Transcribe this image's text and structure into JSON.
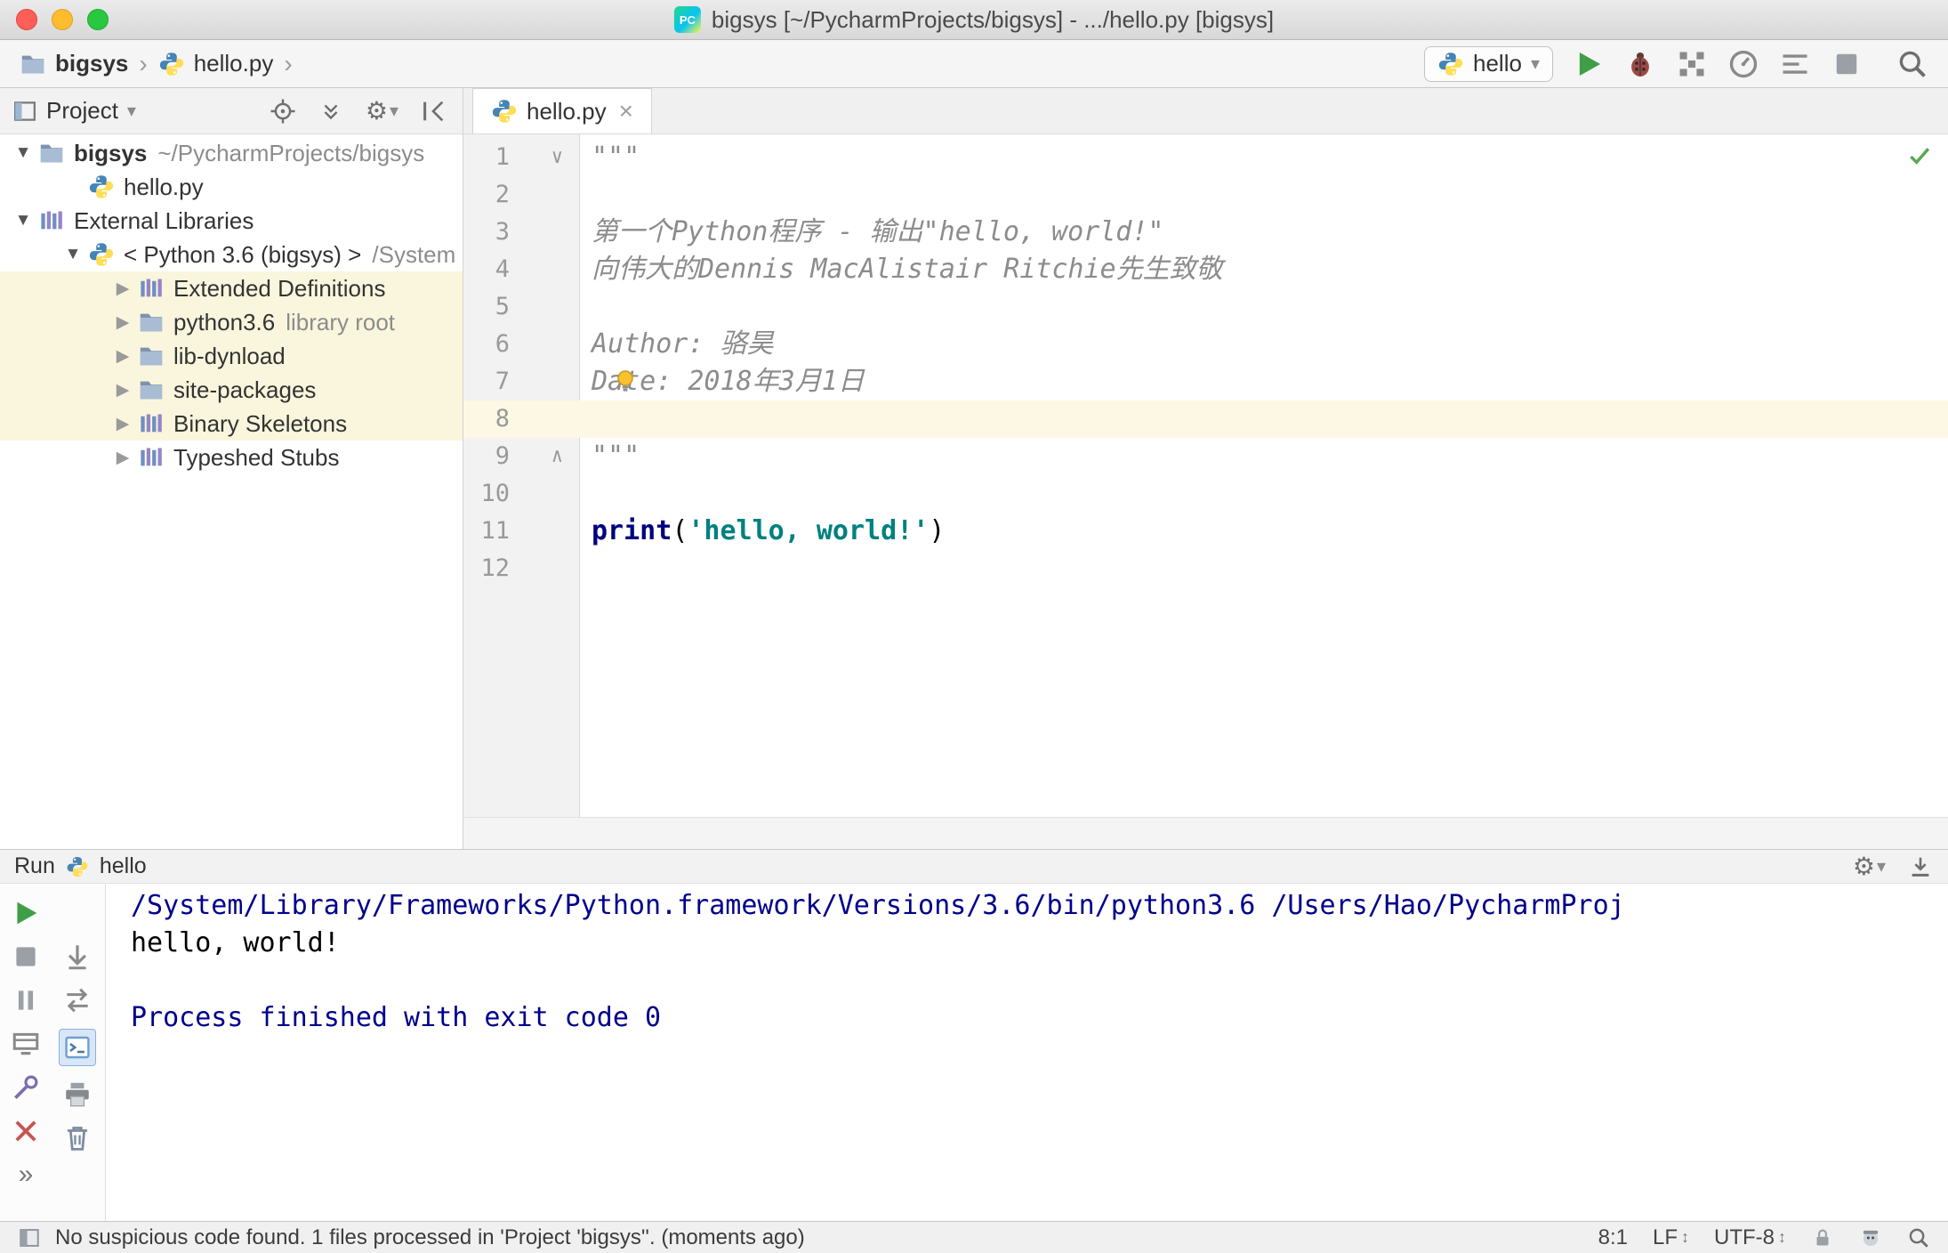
{
  "window": {
    "title": "bigsys [~/PycharmProjects/bigsys] - .../hello.py [bigsys]"
  },
  "navbar": {
    "crumbs": [
      {
        "label": "bigsys"
      },
      {
        "label": "hello.py"
      }
    ],
    "run_config_label": "hello"
  },
  "project": {
    "title": "Project",
    "items": [
      {
        "label": "bigsys",
        "hint": "~/PycharmProjects/bigsys",
        "level": 0,
        "arrow": "expanded",
        "icon": "folder",
        "bold": true,
        "highlight": false
      },
      {
        "label": "hello.py",
        "hint": "",
        "level": 1,
        "arrow": "none",
        "icon": "python",
        "bold": false,
        "highlight": false
      },
      {
        "label": "External Libraries",
        "hint": "",
        "level": 0,
        "arrow": "expanded",
        "icon": "library",
        "bold": false,
        "highlight": false
      },
      {
        "label": "< Python 3.6 (bigsys) >",
        "hint": "/System",
        "level": 1,
        "arrow": "expanded",
        "icon": "python",
        "bold": false,
        "highlight": false
      },
      {
        "label": "Extended Definitions",
        "hint": "",
        "level": 2,
        "arrow": "collapsed",
        "icon": "library",
        "bold": false,
        "highlight": true
      },
      {
        "label": "python3.6",
        "hint": "library root",
        "level": 2,
        "arrow": "collapsed",
        "icon": "folder",
        "bold": false,
        "highlight": true
      },
      {
        "label": "lib-dynload",
        "hint": "",
        "level": 2,
        "arrow": "collapsed",
        "icon": "folder",
        "bold": false,
        "highlight": true
      },
      {
        "label": "site-packages",
        "hint": "",
        "level": 2,
        "arrow": "collapsed",
        "icon": "folder",
        "bold": false,
        "highlight": true
      },
      {
        "label": "Binary Skeletons",
        "hint": "",
        "level": 2,
        "arrow": "collapsed",
        "icon": "library",
        "bold": false,
        "highlight": true
      },
      {
        "label": "Typeshed Stubs",
        "hint": "",
        "level": 2,
        "arrow": "collapsed",
        "icon": "library",
        "bold": false,
        "highlight": false
      }
    ]
  },
  "editor": {
    "tab_label": "hello.py",
    "lines": [
      {
        "n": 1,
        "fold": "open-start",
        "tokens": [
          {
            "text": "\"\"\"",
            "style": "docstring"
          }
        ]
      },
      {
        "n": 2,
        "tokens": []
      },
      {
        "n": 3,
        "tokens": [
          {
            "text": "第一个Python程序 - 输出\"hello, world!\"",
            "style": "docstring"
          }
        ]
      },
      {
        "n": 4,
        "tokens": [
          {
            "text": "向伟大的Dennis MacAlistair Ritchie先生致敬",
            "style": "docstring"
          }
        ]
      },
      {
        "n": 5,
        "tokens": []
      },
      {
        "n": 6,
        "tokens": [
          {
            "text": "Author: 骆昊",
            "style": "docstring"
          }
        ]
      },
      {
        "n": 7,
        "bulb": true,
        "tokens": [
          {
            "text": "Date: 2018年3月1日",
            "style": "docstring"
          }
        ]
      },
      {
        "n": 8,
        "caret": true,
        "tokens": []
      },
      {
        "n": 9,
        "fold": "open-end",
        "tokens": [
          {
            "text": "\"\"\"",
            "style": "docstring"
          }
        ]
      },
      {
        "n": 10,
        "tokens": []
      },
      {
        "n": 11,
        "tokens": [
          {
            "text": "print",
            "style": "keyword"
          },
          {
            "text": "(",
            "style": "plain"
          },
          {
            "text": "'hello, world!'",
            "style": "string"
          },
          {
            "text": ")",
            "style": "plain"
          }
        ]
      },
      {
        "n": 12,
        "tokens": []
      }
    ]
  },
  "run": {
    "title": "Run",
    "config_label": "hello",
    "console": [
      {
        "text": "/System/Library/Frameworks/Python.framework/Versions/3.6/bin/python3.6 /Users/Hao/PycharmProj",
        "style": "system"
      },
      {
        "text": "hello, world!",
        "style": "stdout"
      },
      {
        "text": "",
        "style": "stdout"
      },
      {
        "text": "Process finished with exit code 0",
        "style": "system"
      }
    ]
  },
  "status": {
    "message": "No suspicious code found. 1 files processed in 'Project 'bigsys''. (moments ago)",
    "caret": "8:1",
    "line_sep": "LF",
    "encoding": "UTF-8"
  },
  "icons": {
    "chevron": "›",
    "dropdown": "▾",
    "tree_expanded": "▼",
    "tree_collapsed": "▶",
    "fold_open": "∨",
    "fold_close": "∧",
    "close": "×",
    "gear": "⚙",
    "more": "»",
    "updown": "↕"
  },
  "colors": {
    "caret_line": "#fcf8e3",
    "library_row": "#faf6dd",
    "keyword": "#000080",
    "string": "#008080",
    "docstring": "#8c8c8c",
    "system_console": "#00008b",
    "run_green": "#3f9f46",
    "check_green": "#5aa653"
  }
}
